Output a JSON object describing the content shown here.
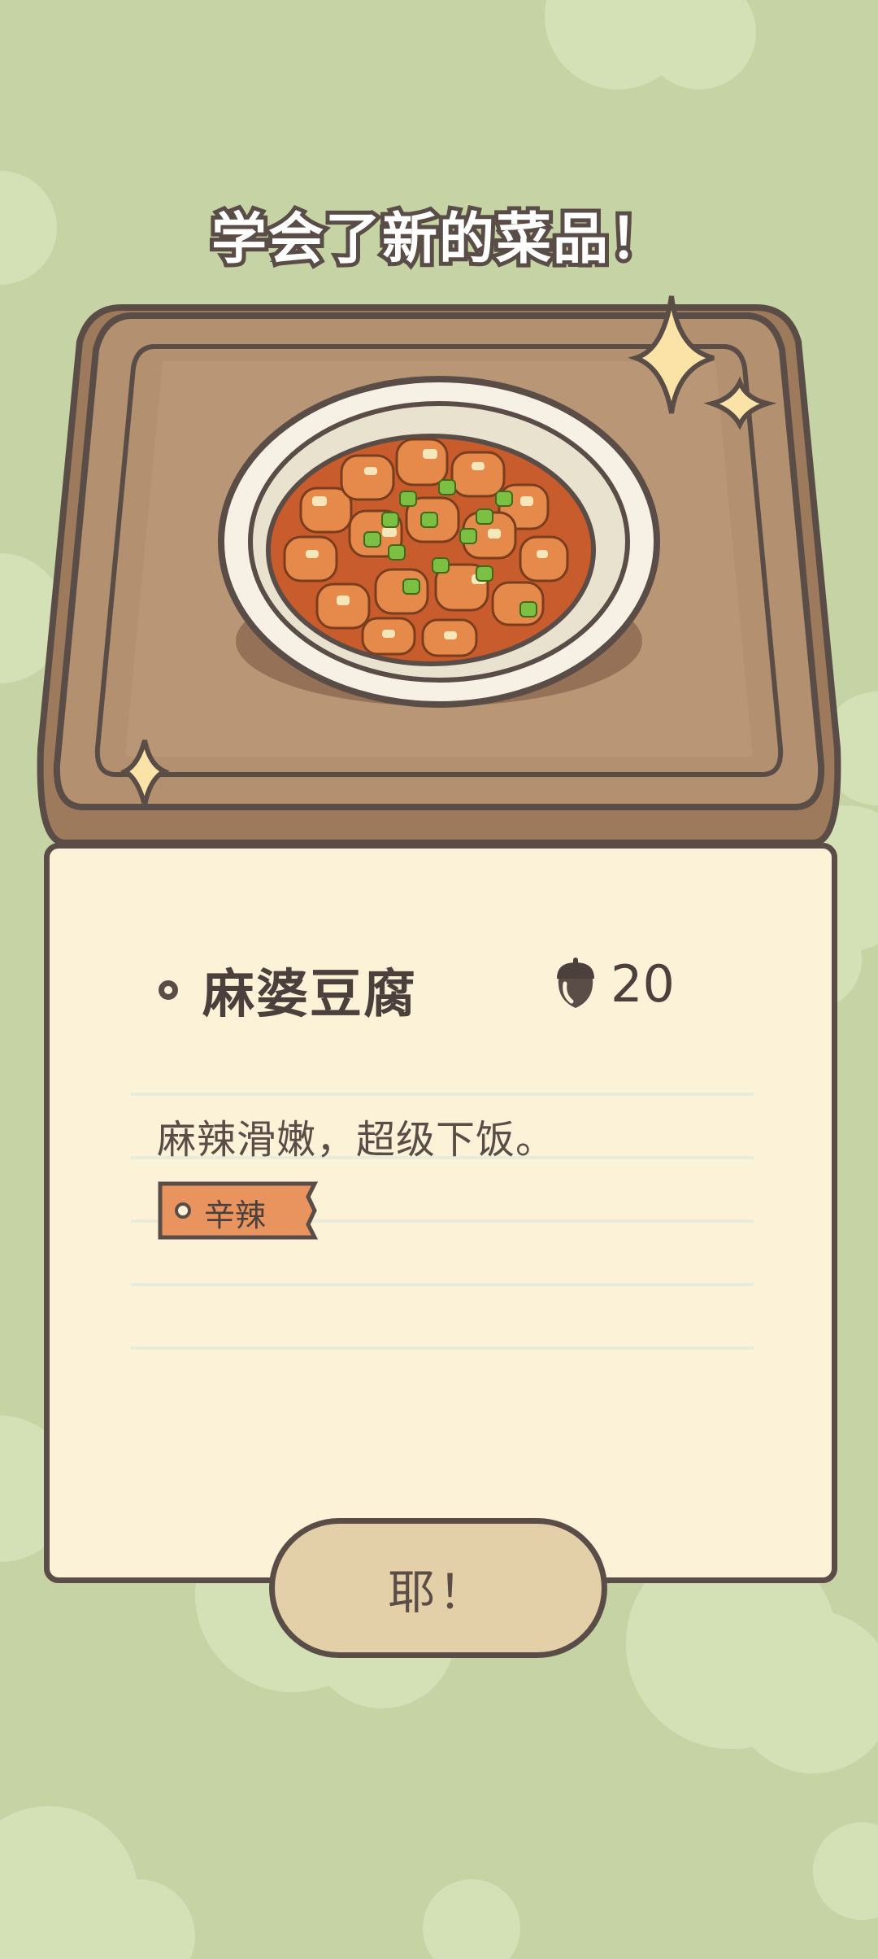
{
  "header": {
    "title": "学会了新的菜品！"
  },
  "dish": {
    "name": "麻婆豆腐",
    "price": "20",
    "price_icon": "acorn-icon",
    "description": "麻辣滑嫩，超级下饭。",
    "tag": "辛辣"
  },
  "confirm_button": {
    "label": "耶！"
  },
  "colors": {
    "background": "#c6d4a5",
    "card": "#fbf2d7",
    "tray": "#b3906f",
    "outline": "#5a4d47",
    "tag": "#e9935e",
    "button": "#e3cfa8"
  }
}
